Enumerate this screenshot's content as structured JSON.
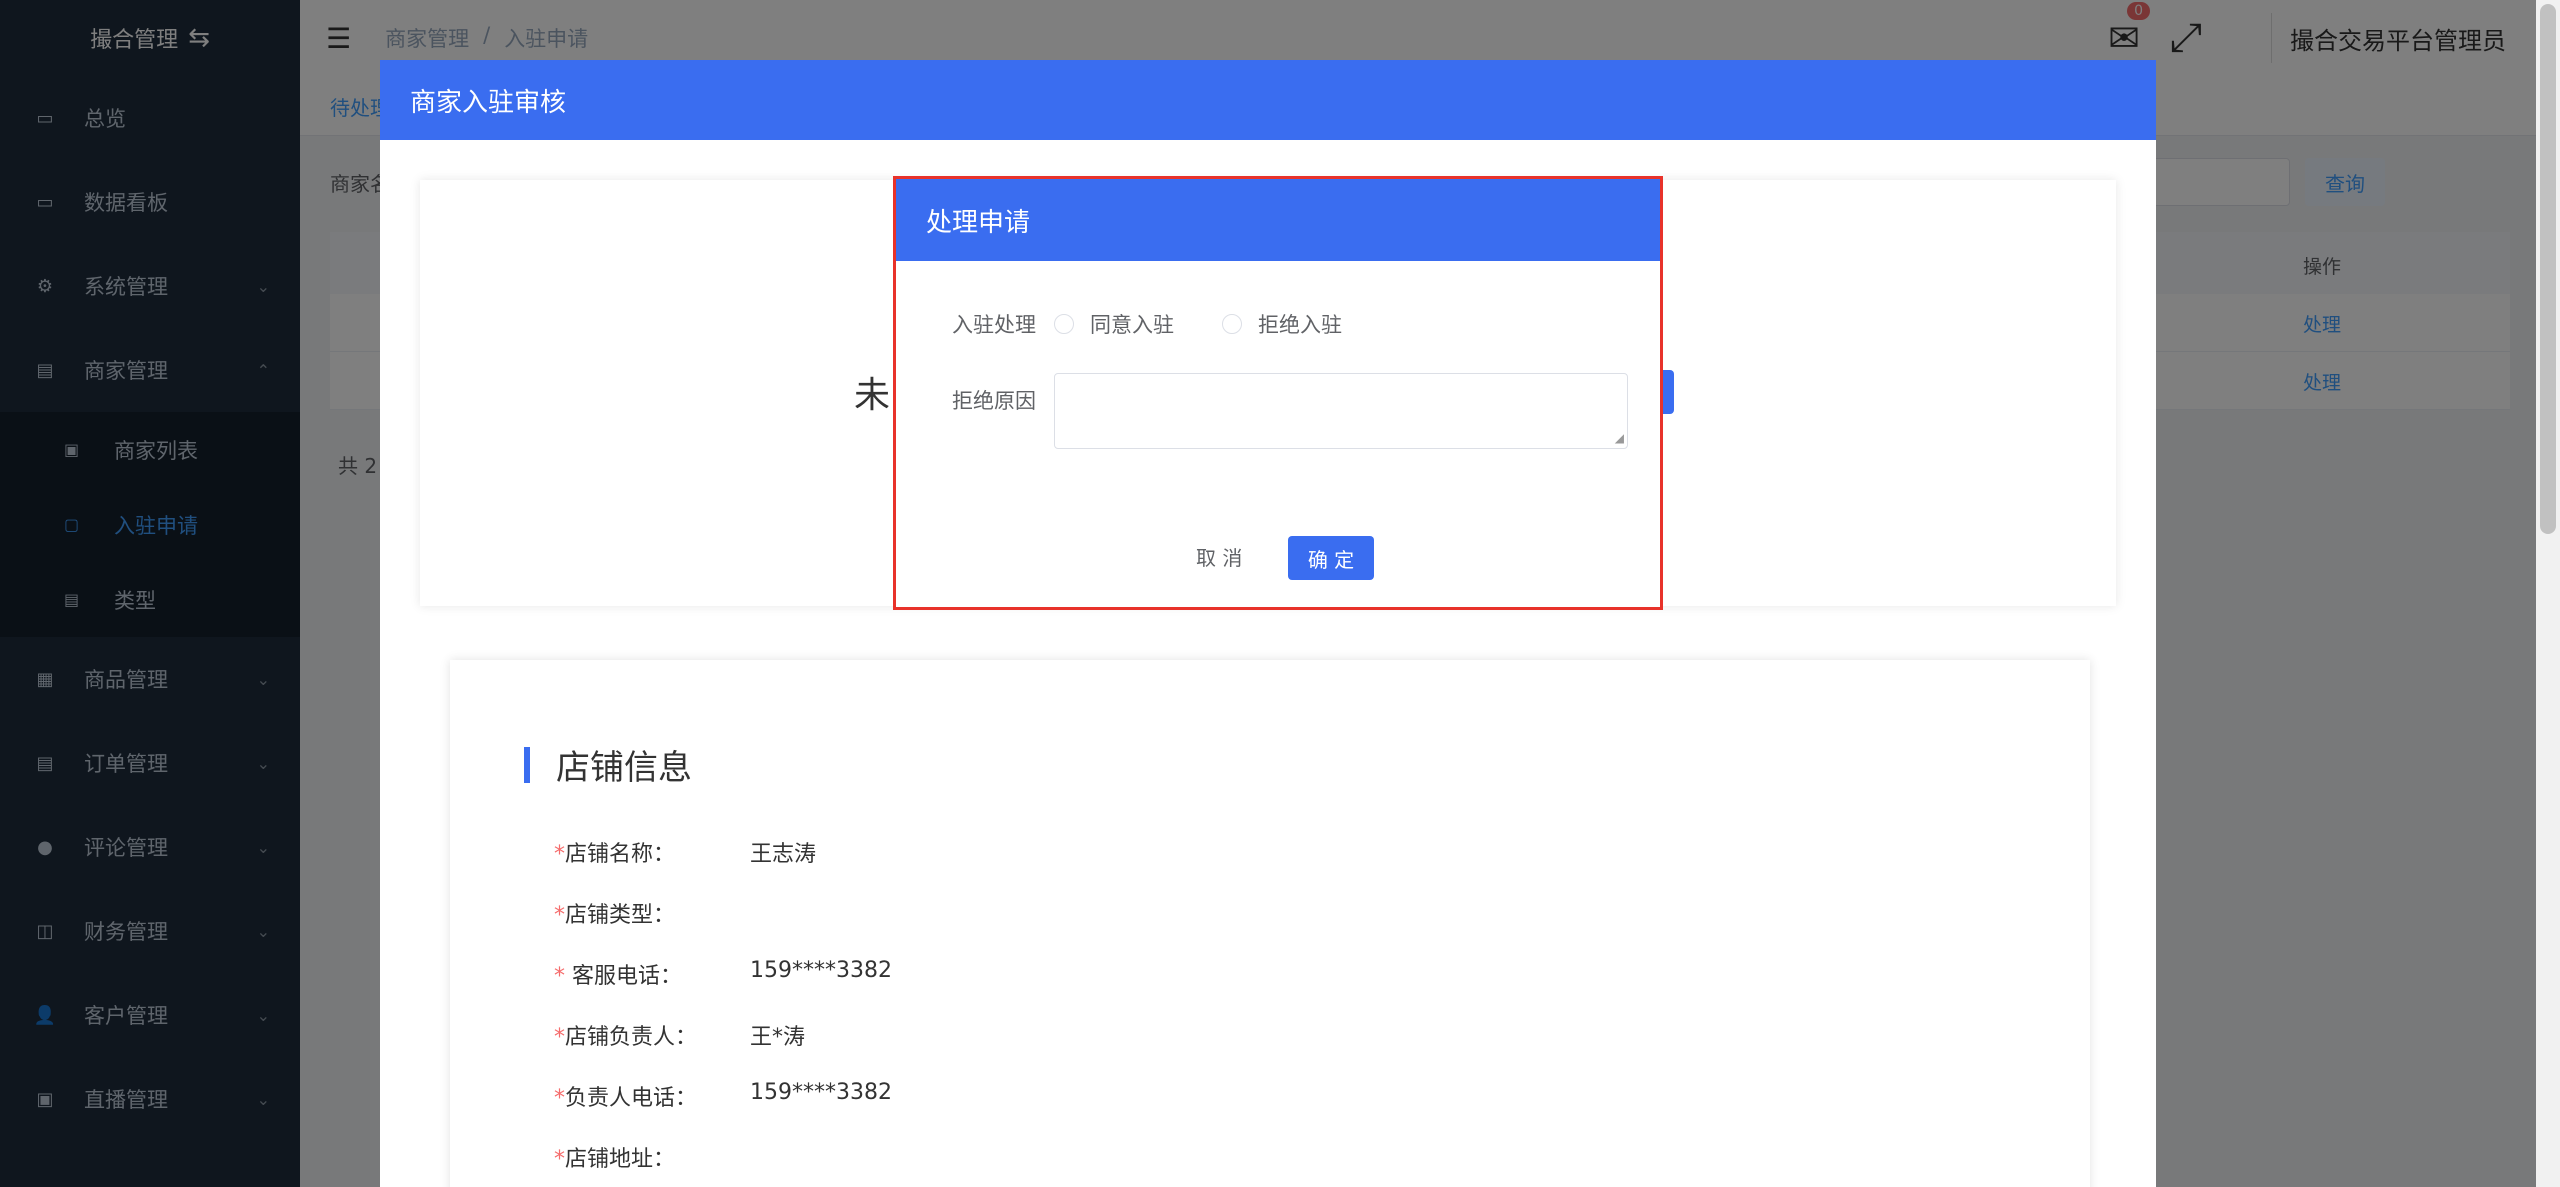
{
  "sidebar": {
    "logo": "撮合管理",
    "items": [
      {
        "label": "总览"
      },
      {
        "label": "数据看板"
      },
      {
        "label": "系统管理"
      },
      {
        "label": "商家管理"
      },
      {
        "label": "商品管理"
      },
      {
        "label": "订单管理"
      },
      {
        "label": "评论管理"
      },
      {
        "label": "财务管理"
      },
      {
        "label": "客户管理"
      },
      {
        "label": "直播管理"
      }
    ],
    "submenu": [
      {
        "label": "商家列表"
      },
      {
        "label": "入驻申请"
      },
      {
        "label": "类型"
      }
    ]
  },
  "header": {
    "breadcrumb_root": "商家管理",
    "breadcrumb_sep": "/",
    "breadcrumb_current": "入驻申请",
    "mail_badge": "0",
    "admin_name": "撮合交易平台管理员"
  },
  "background": {
    "tab_label": "待处理",
    "filter_label": "商家名",
    "query_button": "查询",
    "op_header": "操作",
    "rows": [
      {
        "action": "处理"
      },
      {
        "action": "处理"
      }
    ],
    "total": "共 2"
  },
  "big_dialog": {
    "title": "商家入驻审核",
    "status_text": "未",
    "info_title": "店铺信息",
    "fields": [
      {
        "label": "店铺名称：",
        "value": "王志涛"
      },
      {
        "label": "店铺类型：",
        "value": ""
      },
      {
        "label": " 客服电话：",
        "value": "159****3382"
      },
      {
        "label": "店铺负责人：",
        "value": "王*涛"
      },
      {
        "label": "负责人电话：",
        "value": "159****3382"
      },
      {
        "label": "店铺地址：",
        "value": ""
      }
    ]
  },
  "small_dialog": {
    "title": "处理申请",
    "process_label": "入驻处理",
    "option_agree": "同意入驻",
    "option_reject": "拒绝入驻",
    "reason_label": "拒绝原因",
    "reason_value": "",
    "cancel": "取 消",
    "confirm": "确 定"
  },
  "colors": {
    "sidebar_bg": "#1f2d3d",
    "primary": "#3a6df0",
    "highlight_border": "#e8322a",
    "link": "#409eff"
  }
}
